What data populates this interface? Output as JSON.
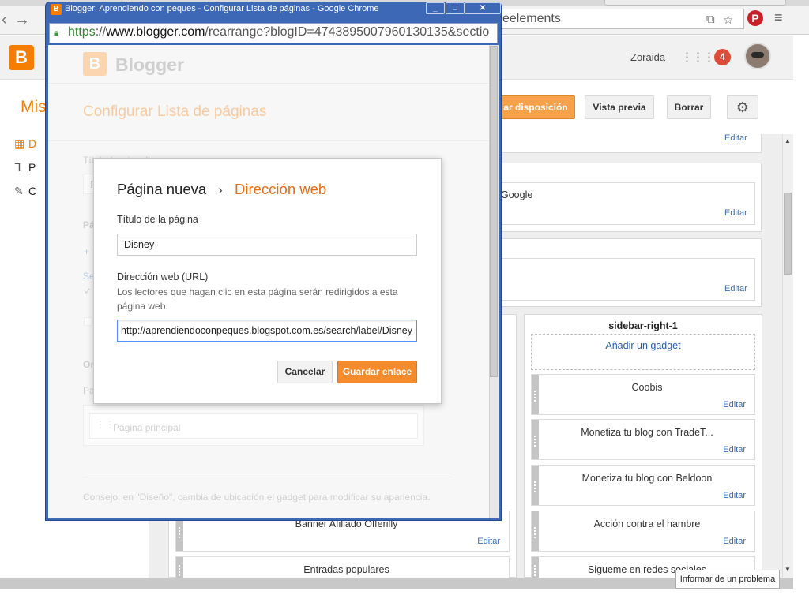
{
  "background": {
    "omnibox_text": "eelements",
    "header": {
      "user_name": "Zoraida",
      "notification_count": "4"
    },
    "subheader": {
      "title_partial": "Mis",
      "buttons": {
        "save_arrangement_partial": "ar disposición",
        "preview": "Vista previa",
        "delete": "Borrar"
      }
    },
    "sidebar_items": [
      "D",
      "P",
      "C"
    ],
    "layout": {
      "top_edit": "Editar",
      "google_gadget": {
        "name": "Google",
        "edit": "Editar"
      },
      "middle_gadget": {
        "marker": ":",
        "edit": "Editar"
      },
      "sidebar_right": {
        "title": "sidebar-right-1",
        "add_gadget": "Añadir un gadget",
        "gadgets": [
          {
            "name": "Coobis",
            "edit": "Editar"
          },
          {
            "name": "Monetiza tu blog con TradeT...",
            "edit": "Editar"
          },
          {
            "name": "Monetiza tu blog con Beldoon",
            "edit": "Editar"
          },
          {
            "name": "Acción contra el hambre",
            "edit": "Editar"
          },
          {
            "name": "Sigueme en redes sociales",
            "edit": ""
          }
        ]
      },
      "main_gadgets": [
        {
          "name": "Banner Afiliado Offerilly",
          "edit": "Editar"
        },
        {
          "name": "Entradas populares",
          "edit": ""
        }
      ]
    },
    "report_problem": "Informar de un problema"
  },
  "popup": {
    "window_title": "Blogger: Aprendiendo con peques - Configurar Lista de páginas - Google Chrome",
    "url": {
      "scheme": "https",
      "separator": "://",
      "host": "www.blogger.com",
      "rest": "/rearrange?blogID=4743895007960130135&sectio"
    },
    "brand": "Blogger",
    "page_heading": "Configurar Lista de páginas",
    "dimmed": {
      "title_label": "Título (opcional):",
      "title_value": "P",
      "pages_label": "Pá",
      "add_link": "+",
      "select_link": "Se",
      "order_label": "Or",
      "order_sub": "Pa",
      "main_page": "Página principal",
      "tip": "Consejo: en \"Diseño\", cambia de ubicación el gadget para modificar su apariencia."
    },
    "dialog": {
      "breadcrumb_root": "Página nueva",
      "breadcrumb_sep": "›",
      "breadcrumb_current": "Dirección web",
      "page_title_label": "Título de la página",
      "page_title_value": "Disney",
      "url_label": "Dirección web (URL)",
      "url_help": "Los lectores que hagan clic en esta página serán redirigidos a esta página web.",
      "url_value": "http://aprendiendoconpeques.blogspot.com.es/search/label/Disney",
      "cancel_label": "Cancelar",
      "save_label": "Guardar enlace"
    }
  },
  "colors": {
    "blogger_orange": "#f57d00",
    "dialog_accent": "#e86c10",
    "link_blue": "#3b6cb5",
    "window_frame": "#3d68b6"
  }
}
